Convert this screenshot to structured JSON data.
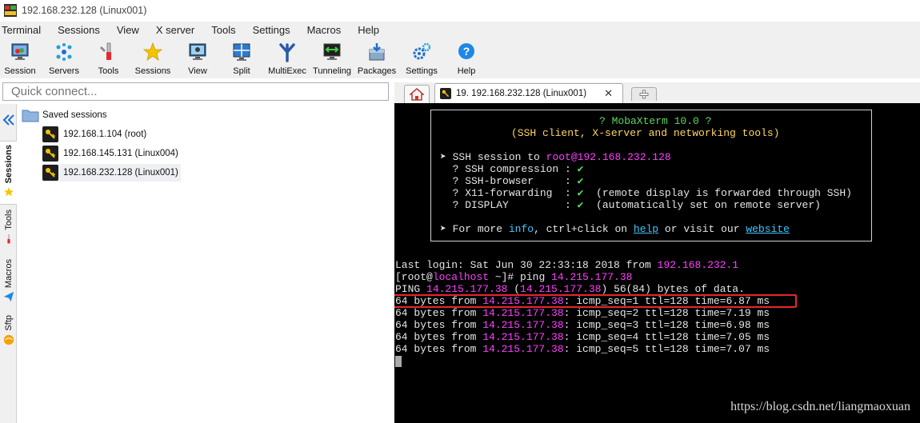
{
  "window": {
    "title": "192.168.232.128 (Linux001)"
  },
  "menu": [
    "Terminal",
    "Sessions",
    "View",
    "X server",
    "Tools",
    "Settings",
    "Macros",
    "Help"
  ],
  "toolbar": {
    "session": "Session",
    "servers": "Servers",
    "tools": "Tools",
    "sessions": "Sessions",
    "view": "View",
    "split": "Split",
    "multiexec": "MultiExec",
    "tunneling": "Tunneling",
    "packages": "Packages",
    "settings": "Settings",
    "help": "Help"
  },
  "quick_connect": {
    "placeholder": "Quick connect..."
  },
  "side_tabs": {
    "sessions": "Sessions",
    "tools": "Tools",
    "macros": "Macros",
    "sftp": "Sftp"
  },
  "sessions_tree": {
    "root": "Saved sessions",
    "items": [
      "192.168.1.104 (root)",
      "192.168.145.131 (Linux004)",
      "192.168.232.128 (Linux001)"
    ]
  },
  "tabs": {
    "active": "19. 192.168.232.128 (Linux001)",
    "close": "✕"
  },
  "terminal": {
    "banner_title": "? MobaXterm 10.0 ?",
    "banner_subtitle": "(SSH client, X-server and networking tools)",
    "ssh_prefix": "➤ SSH session to ",
    "ssh_user": "root",
    "ssh_host": "@192.168.232.128",
    "features": [
      {
        "label": "  ? SSH compression : ",
        "mark": "✔",
        "note": ""
      },
      {
        "label": "  ? SSH-browser     : ",
        "mark": "✔",
        "note": ""
      },
      {
        "label": "  ? X11-forwarding  : ",
        "mark": "✔",
        "note": "  (remote display is forwarded through SSH)"
      },
      {
        "label": "  ? DISPLAY         : ",
        "mark": "✔",
        "note": "  (automatically set on remote server)"
      }
    ],
    "more_prefix": "➤ For more ",
    "more_info": "info",
    "more_mid": ", ctrl+click on ",
    "more_help": "help",
    "more_or": " or visit our ",
    "more_website": "website",
    "last_login_prefix": "Last login: Sat Jun 30 22:33:18 2018 from ",
    "last_login_ip": "192.168.232.1",
    "prompt_open": "[root@",
    "prompt_host": "localhost",
    "prompt_rest": " ~]# ping ",
    "ping_target": "14.215.177.38",
    "ping_line_prefix": "PING ",
    "ping_ip": "14.215.177.38",
    "ping_open_paren": " (",
    "ping_ip2": "14.215.177.38",
    "ping_line_suffix": ") 56(84) bytes of data.",
    "reply_prefix": "64 bytes from ",
    "replies": [
      {
        "ip": "14.215.177.38",
        "rest": ": icmp_seq=1 ttl=128 time=6.87 ms"
      },
      {
        "ip": "14.215.177.38",
        "rest": ": icmp_seq=2 ttl=128 time=7.19 ms"
      },
      {
        "ip": "14.215.177.38",
        "rest": ": icmp_seq=3 ttl=128 time=6.98 ms"
      },
      {
        "ip": "14.215.177.38",
        "rest": ": icmp_seq=4 ttl=128 time=7.05 ms"
      },
      {
        "ip": "14.215.177.38",
        "rest": ": icmp_seq=5 ttl=128 time=7.07 ms"
      }
    ]
  },
  "watermark": "https://blog.csdn.net/liangmaoxuan",
  "colors": {
    "terminal_bg": "#000000",
    "accent_green": "#5fd75f",
    "accent_yellow": "#ffd75f",
    "ip_magenta": "#ff40ff",
    "link_cyan": "#3fc8ff",
    "highlight_red": "#e8262d"
  }
}
